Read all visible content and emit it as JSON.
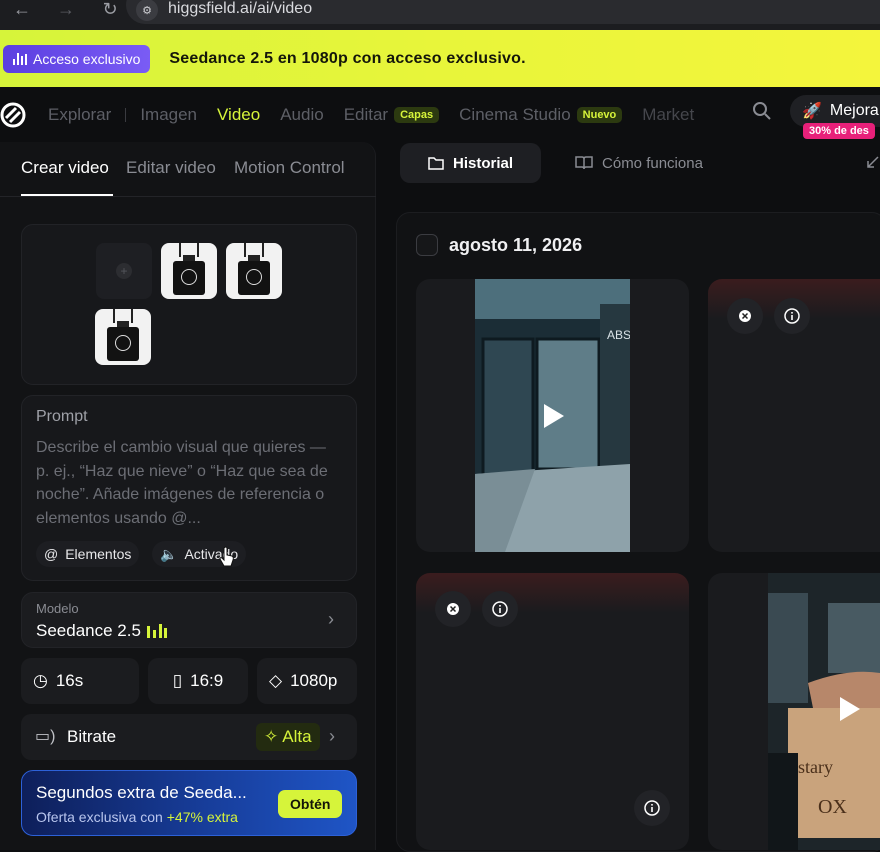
{
  "browser": {
    "url": "higgsfield.ai/ai/video",
    "back_icon": "arrow-left-icon",
    "forward_icon": "arrow-right-icon",
    "reload_icon": "reload-icon"
  },
  "banner": {
    "pill_label": "Acceso exclusivo",
    "text": "Seedance 2.5 en 1080p con acceso exclusivo.",
    "color_start": "#d6f43a",
    "pill_color": "#6a4bea"
  },
  "nav": {
    "items": [
      {
        "label": "Explorar"
      },
      {
        "label": "Imagen"
      },
      {
        "label": "Video"
      },
      {
        "label": "Audio"
      },
      {
        "label": "Editar",
        "badge": "Capas"
      },
      {
        "label": "Cinema Studio",
        "badge": "Nuevo"
      },
      {
        "label": "Market"
      }
    ],
    "active": "Video",
    "upgrade_label": "Mejora",
    "discount_label": "30% de des",
    "accent": "#d6f43a"
  },
  "left": {
    "tabs": [
      "Crear video",
      "Editar video",
      "Motion Control"
    ],
    "active_tab": "Crear video",
    "prompt": {
      "label": "Prompt",
      "placeholder": "Describe el cambio visual que quieres — p. ej., “Haz que nieve” o “Haz que sea de noche”. Añade imágenes de referencia o elementos usando @...",
      "chip_elements": "Elementos",
      "chip_audio": "Activado"
    },
    "model": {
      "label": "Modelo",
      "value": "Seedance 2.5"
    },
    "options": {
      "duration": "16s",
      "aspect": "16:9",
      "resolution": "1080p"
    },
    "bitrate": {
      "label": "Bitrate",
      "value": "Alta"
    },
    "promo": {
      "title": "Segundos extra de Seeda...",
      "subtitle_prefix": "Oferta exclusiva con",
      "subtitle_highlight": "+47% extra",
      "button": "Obtén"
    }
  },
  "right": {
    "tabs": [
      "Historial",
      "Cómo funciona"
    ],
    "active_tab": "Historial",
    "date": "agosto 11, 2026"
  }
}
